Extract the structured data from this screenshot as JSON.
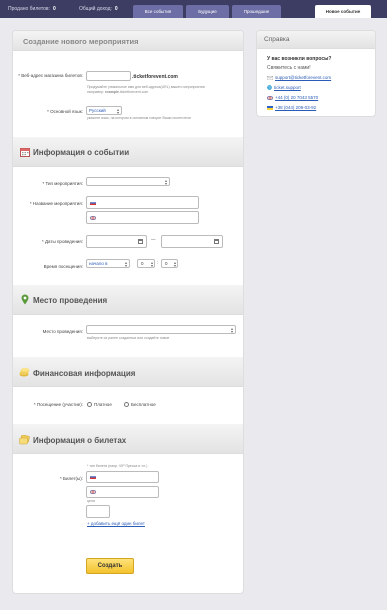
{
  "topbar": {
    "sold_label": "Продано билетов:",
    "sold_value": "0",
    "total_label": "Общий доход:",
    "total_value": "0",
    "tabs": [
      "Все события",
      "Будущие",
      "Прошедшие",
      "Новое событие"
    ]
  },
  "main": {
    "title": "Создание нового мероприятия",
    "url_label": "* Веб-адрес магазина билетов:",
    "url_suffix": ".ticketforevent.com",
    "url_hint_1": "Придумайте уникальное имя для веб-адреса(URL) вашего мероприятия",
    "url_hint_2": "например:",
    "url_hint_example": "example",
    "url_hint_3": ".ticketforevent.com",
    "lang_label": "* Основной язык:",
    "lang_value": "Русский",
    "lang_hint": "укажите язык, на котором в основном говорят Ваши посетители"
  },
  "info": {
    "title": "Информация о событии",
    "type_label": "* Тип мероприятия:",
    "name_label": "* Название мероприятия:",
    "dates_label": "* Даты проведения:",
    "dash": "—",
    "time_label": "Время посещения:",
    "time_value": "начало в",
    "hour_value": "0",
    "min_value": "0",
    "colon": ":"
  },
  "venue": {
    "title": "Место проведения",
    "place_label": "Место проведения:",
    "place_hint": "выберите из ранее созданных или создайте новое"
  },
  "finance": {
    "title": "Финансовая информация",
    "attendance_label": "* Посещение (участие):",
    "option_paid": "Платное",
    "option_free": "Бесплатное"
  },
  "tickets": {
    "title": "Информация о билетах",
    "ticket_label": "* Билет(ы):",
    "ticket_hint": "* тип билета (напр. VIP Пресса и т.п.)",
    "price_hint": "цена",
    "add_link": "+ добавить ещё один билет"
  },
  "submit": "Создать",
  "sidebar": {
    "title": "Справка",
    "question": "У вас возникли вопросы?",
    "contact": "Свяжитесь с нами!",
    "email": "support@ticketforevent.com",
    "skype": "ticket.support",
    "phone_uk": "+44 (0) 20 7043 5570",
    "phone_ua": "+38 (044) 209-03-92"
  },
  "colors": {
    "topbar": "#3d3d63",
    "tab": "#6e6ea6",
    "link": "#2a5bb7",
    "button": "#f3c22e"
  },
  "icons": [
    "calendar-icon",
    "map-pin-icon",
    "coins-icon",
    "tickets-icon",
    "email-icon",
    "skype-icon",
    "uk-flag-icon",
    "ua-flag-icon"
  ]
}
